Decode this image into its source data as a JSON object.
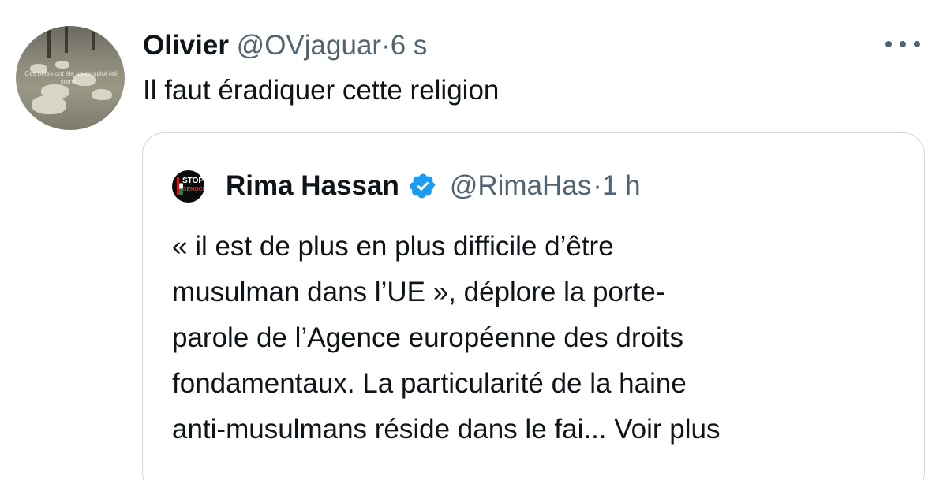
{
  "tweet": {
    "author_name": "Olivier",
    "author_handle": "@OVjaguar",
    "separator": "·",
    "time": "6 s",
    "text": "Il faut éradiquer cette religion",
    "avatar_overlay_text": "Ces bêtes ont été un complot été sorrel..."
  },
  "quote": {
    "author_name": "Rima Hassan",
    "author_handle": "@RimaHas",
    "separator": "·",
    "time": "1 h",
    "avatar_text_top": "STOP",
    "avatar_text_bottom": "GENOCIDE",
    "text_lines": [
      "« il est de plus en plus difficile d’être",
      "musulman dans l’UE », déplore la porte-",
      "parole de l’Agence européenne des droits",
      "fondamentaux. La particularité de la haine",
      "anti-musulmans réside dans le fai... "
    ],
    "see_more": "Voir plus"
  },
  "icons": {
    "more": "more-dots-icon",
    "verified": "verified-badge-icon"
  },
  "colors": {
    "text_primary": "#0f1419",
    "text_secondary": "#536471",
    "border": "#cfd9de",
    "verified_blue": "#1d9bf0"
  }
}
